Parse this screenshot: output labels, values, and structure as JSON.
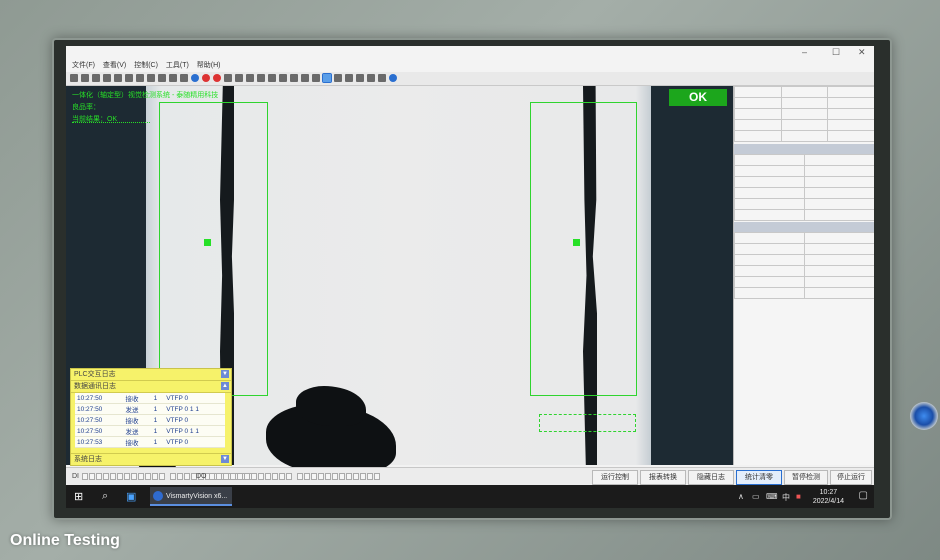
{
  "menu": [
    "文件(F)",
    "查看(V)",
    "控制(C)",
    "工具(T)",
    "帮助(H)"
  ],
  "window_buttons": {
    "minimize": "–",
    "maximize": "☐",
    "close": "✕"
  },
  "status_overlay": {
    "line1": "一体化（轴定型）视觉检测系统 - 泰随精用科技",
    "line2": "良品率：",
    "line3": "当前结果：OK"
  },
  "result_badge": "OK",
  "logs": {
    "plc_title": "PLC交互日志",
    "comm_title": "数据通讯日志",
    "system_title": "系统日志",
    "rows": [
      {
        "time": "10:27:50",
        "dir": "接收",
        "n": "1",
        "msg": "VTFP 0"
      },
      {
        "time": "10:27:50",
        "dir": "发送",
        "n": "1",
        "msg": "VTFP 0 1 1"
      },
      {
        "time": "10:27:50",
        "dir": "接收",
        "n": "1",
        "msg": "VTFP 0"
      },
      {
        "time": "10:27:50",
        "dir": "发送",
        "n": "1",
        "msg": "VTFP 0 1 1"
      },
      {
        "time": "10:27:53",
        "dir": "接收",
        "n": "1",
        "msg": "VTFP 0"
      }
    ]
  },
  "io": {
    "di_label": "DI",
    "do_label": "DO"
  },
  "buttons": {
    "run_control": "运行控制",
    "report_switch": "报表转换",
    "hide_log": "隐藏日志",
    "stats_clear": "统计清零",
    "pause_detect": "暂停检测",
    "stop_run": "停止运行"
  },
  "taskbar": {
    "app_label": "VismartyVision x6...",
    "ime": "中",
    "time": "10:27",
    "date": "2022/4/14"
  },
  "caption": "Online Testing"
}
